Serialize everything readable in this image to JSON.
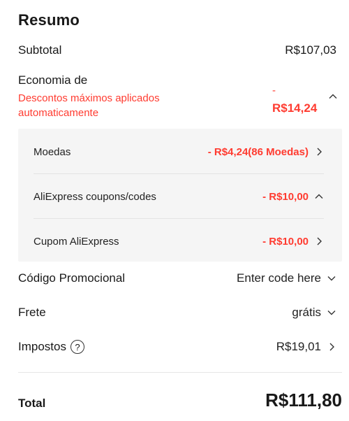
{
  "summary": {
    "title": "Resumo",
    "subtotal": {
      "label": "Subtotal",
      "value": "R$107,03"
    },
    "savings": {
      "label": "Economia de",
      "note": "Descontos máximos aplicados automaticamente",
      "minus": "-",
      "value": "R$14,24"
    },
    "breakdown": [
      {
        "label": "Moedas",
        "value": "- R$4,24(86 Moedas)"
      },
      {
        "label": "AliExpress coupons/codes",
        "value": "- R$10,00"
      },
      {
        "label": "Cupom AliExpress",
        "value": "- R$10,00"
      }
    ],
    "promo": {
      "label": "Código Promocional",
      "value": "Enter code here"
    },
    "shipping": {
      "label": "Frete",
      "value": "grátis"
    },
    "taxes": {
      "label": "Impostos",
      "help": "?",
      "value": "R$19,01"
    },
    "total": {
      "label": "Total",
      "value": "R$111,80"
    }
  },
  "colors": {
    "accent": "#ff3b30",
    "text": "#191919",
    "panel_bg": "#f5f5f5"
  }
}
